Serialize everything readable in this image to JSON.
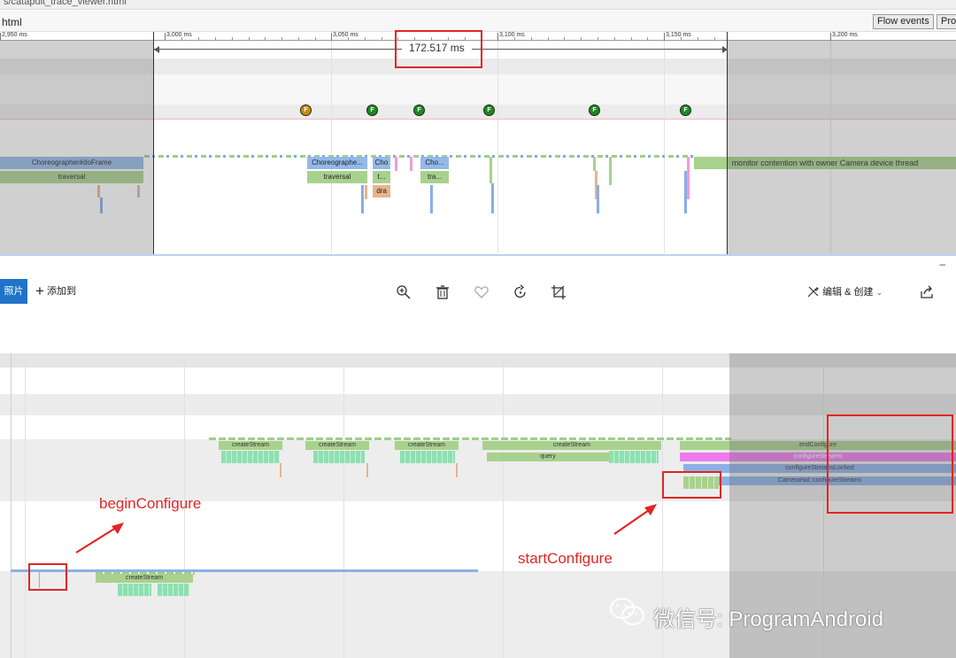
{
  "top_window": {
    "url_fragment": "s/catapult_trace_viewer.html",
    "file_title": "html",
    "buttons": {
      "flow_events": "Flow events",
      "pro": "Pro"
    },
    "ruler_labels": [
      "2,950 ms",
      "3,000 ms",
      "3,050 ms",
      "3,100 ms",
      "3,150 ms",
      "3,200 ms"
    ],
    "measure_label": "172.517 ms",
    "flow_markers": [
      "F",
      "F",
      "F",
      "F",
      "F",
      "F"
    ],
    "slices": {
      "choreographer_left": "Choreographer#doFrame",
      "traversal_left": "traversal",
      "choreographer_mid": "Choreographe...",
      "traversal_mid": "traversal",
      "cho_a": "Cho",
      "t_a": "t...",
      "dra": "dra",
      "cho_b": "Cho...",
      "tra_b": "tra...",
      "monitor": "monitor contention with owner Camera device thread"
    }
  },
  "photos_bar": {
    "photos_button": "照片",
    "add_to": "添加到",
    "edit_create": "编辑 & 创建",
    "minimize": "–",
    "icons": [
      "zoom-in-icon",
      "delete-icon",
      "heart-icon",
      "rotate-icon",
      "crop-icon",
      "edit-create-icon",
      "chevron-down-icon",
      "share-icon"
    ]
  },
  "lower_trace": {
    "create_stream_labels": [
      "createStream",
      "createStream",
      "createStream",
      "createStream",
      "createStream"
    ],
    "query": "query",
    "right_stack": {
      "end_configure": "endConfigure",
      "configure_streams": "configureStreams",
      "configure_streams_locked": "configureStreamsLocked",
      "camerahal": "CameraHal::configureStreams"
    },
    "annotations": {
      "begin_configure": "beginConfigure",
      "start_configure": "startConfigure"
    },
    "watermark": "微信号: ProgramAndroid"
  },
  "colors": {
    "annotation_red": "#e32424",
    "slice_blue": "#93b9e8",
    "slice_green": "#a9d18e",
    "slice_mint": "#8ee0b0",
    "slice_magenta": "#ee7aee",
    "photos_blue": "#1f73c8"
  }
}
